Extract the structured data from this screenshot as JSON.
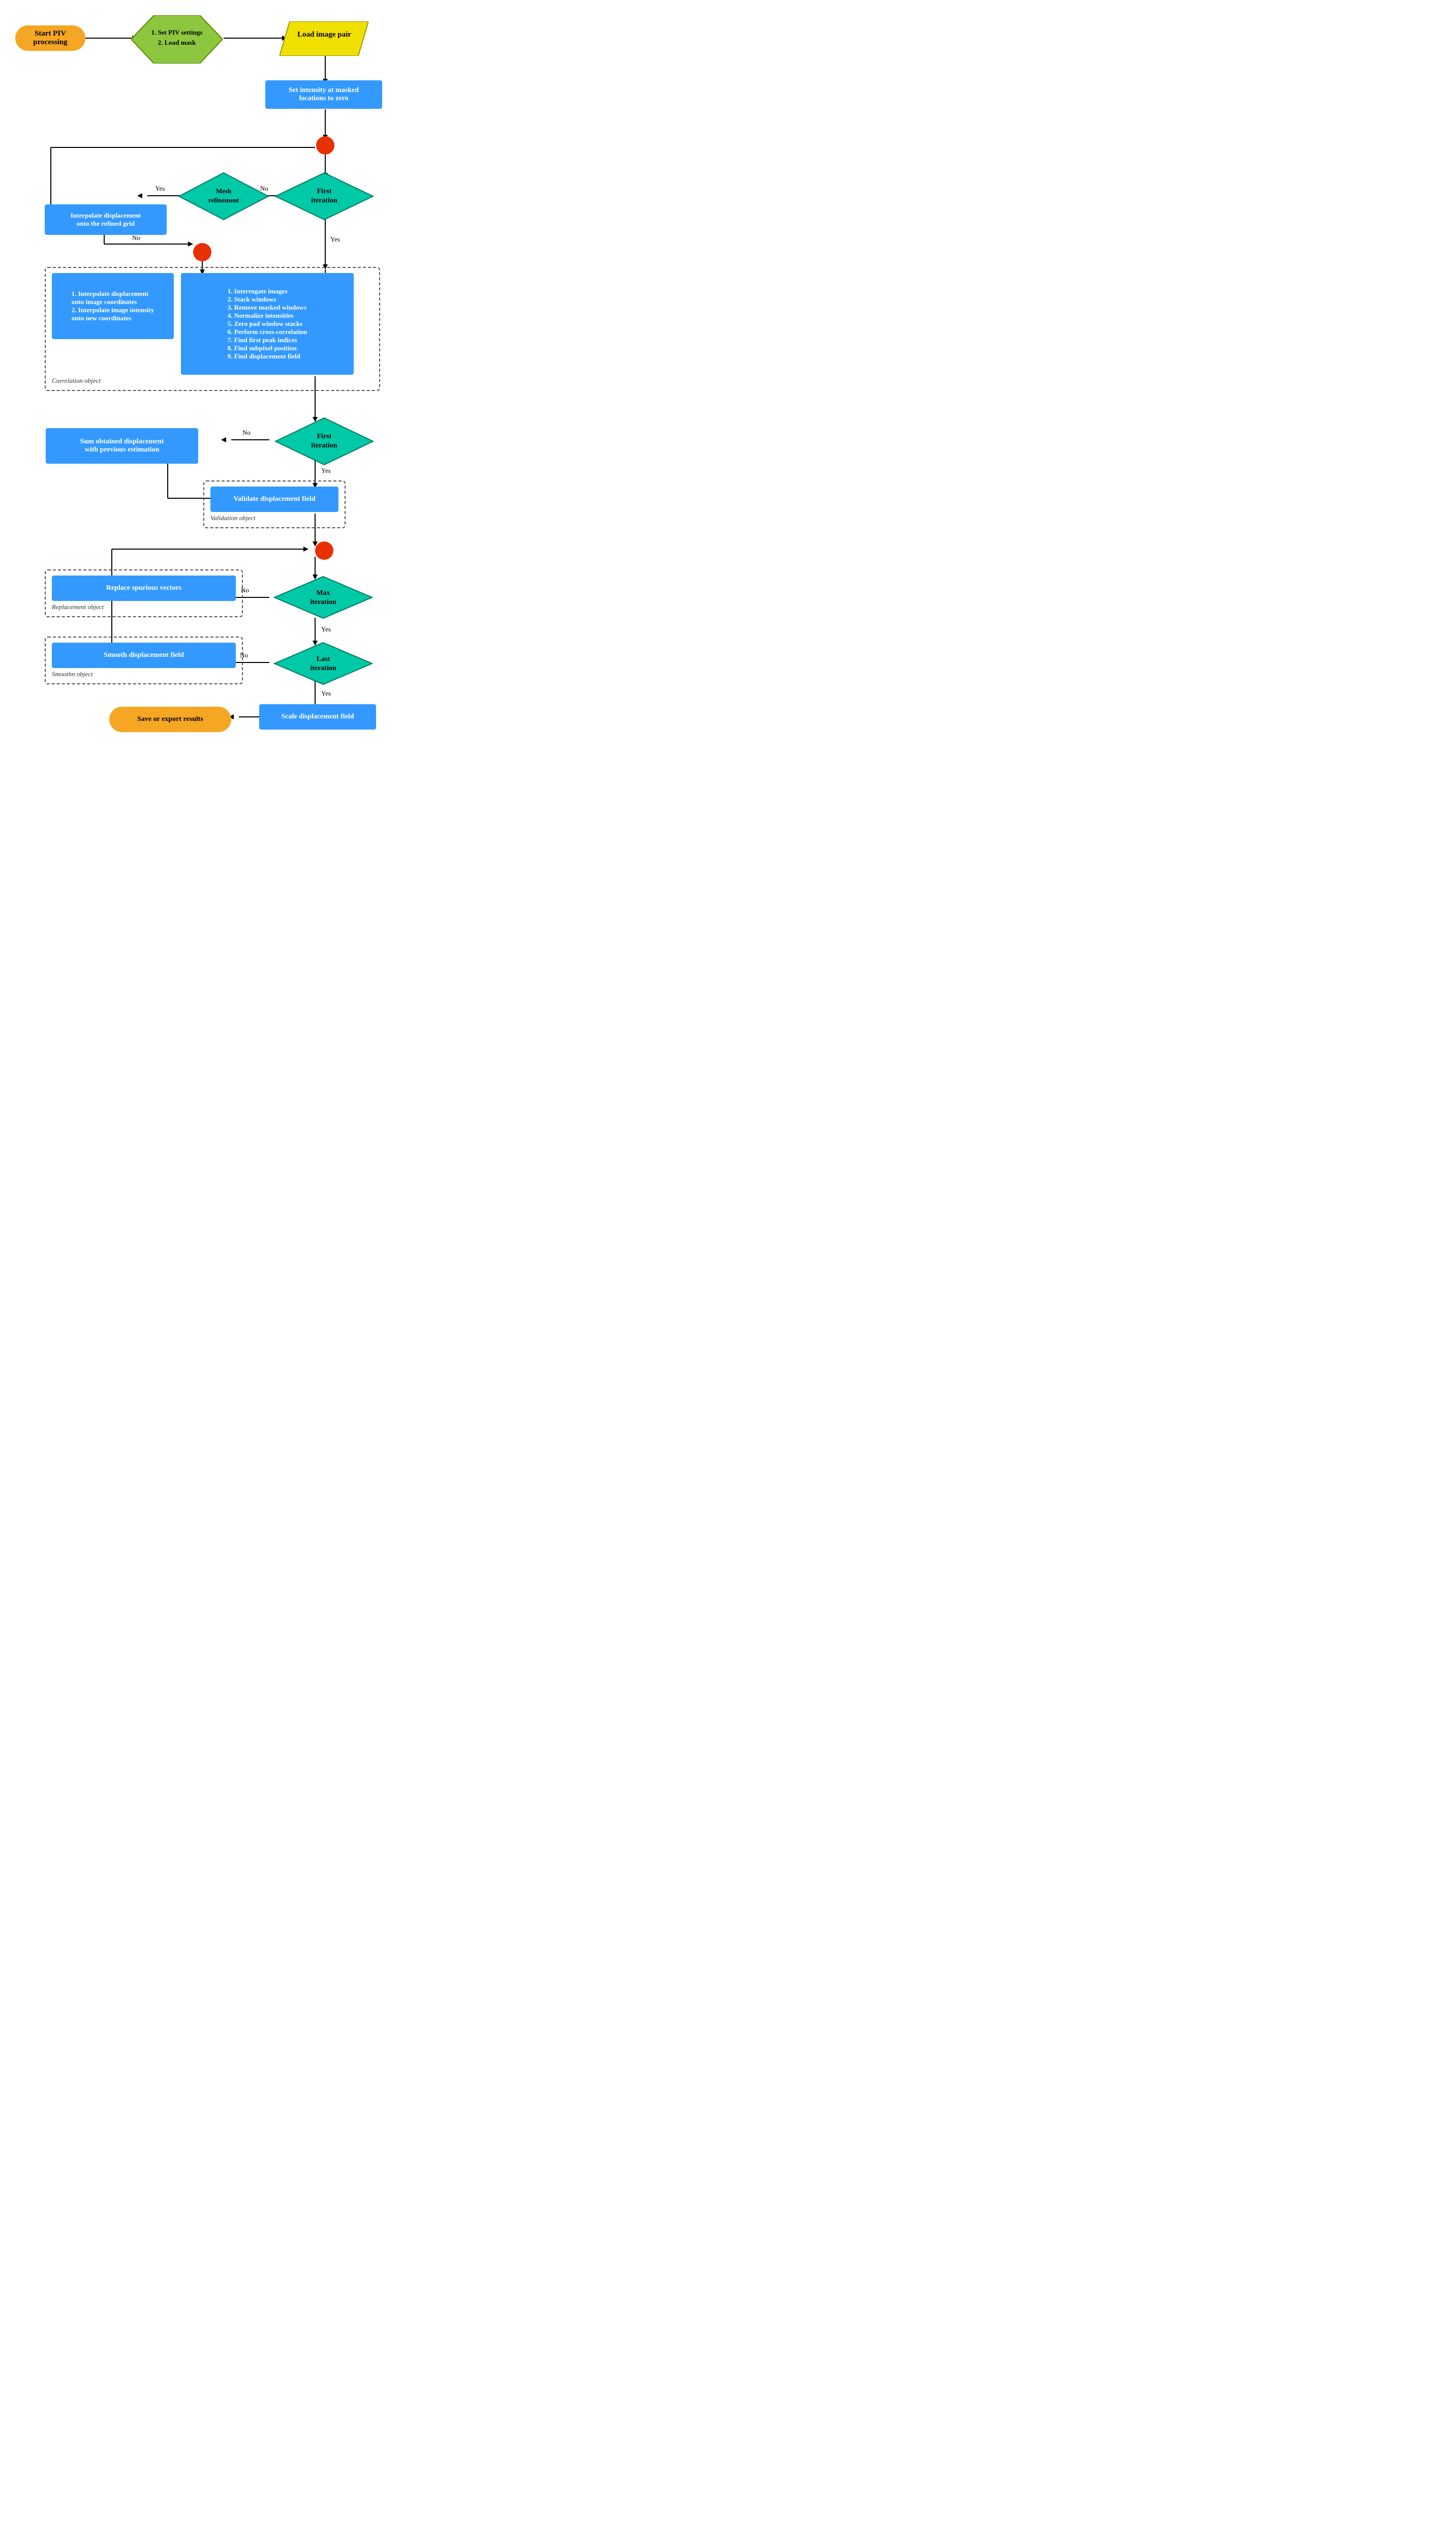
{
  "nodes": {
    "start": "Start PIV processing",
    "settings": "1. Set PIV settings\n2. Load mask",
    "loadImage": "Load image pair",
    "setIntensity": "Set intensity at masked\nlocations to zero",
    "circle1": "",
    "firstIter1": "First iteration",
    "meshRefinement": "Mesh refinement",
    "interpolateGrid": "Interpolate displacement\nonto the refined grid",
    "circle2": "",
    "interpolateBlock": "1. Interpolate displacement\nonto image coordinates\n2. Interpolate image intensity\nonto new coordinates",
    "correlationSteps": "1. Interrogate images\n2. Stack windows\n3. Remove masked windows\n4. Normalize intensities\n5. Zero pad window stacks\n6. Perform cross-correlation\n7. Find first peak indices\n8. Find subpixel position\n9. Find displacement field",
    "correlationLabel": "Correlation object",
    "firstIter2": "First iteration",
    "sumDisplacement": "Sum obtained displacement\nwith previous estimation",
    "validateDisp": "Validate displacement field",
    "validationLabel": "Validation object",
    "circle3": "",
    "maxIter": "Max iteration",
    "replaceVectors": "Replace spurious vectors",
    "replacementLabel": "Replacement object",
    "lastIter": "Last iteration",
    "smoothDisp": "Smooth displacement field",
    "smoothLabel": "Smoothn object",
    "scaleDisp": "Scale displacement field",
    "saveExport": "Save or export results",
    "yes": "Yes",
    "no": "No"
  },
  "arrows": {
    "labels": [
      "Yes",
      "No"
    ]
  }
}
